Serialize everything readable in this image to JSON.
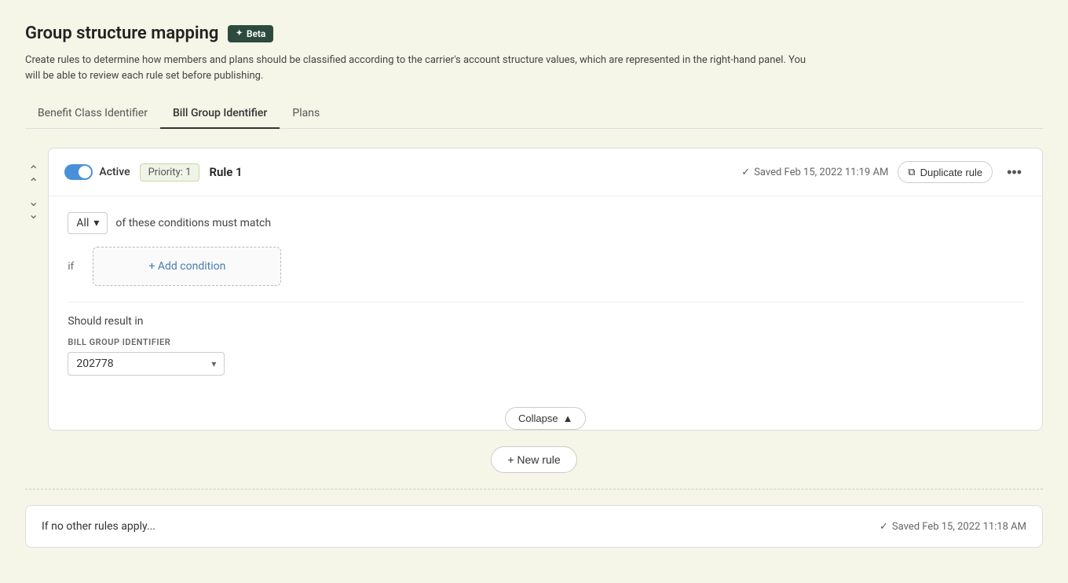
{
  "page": {
    "title": "Group structure mapping",
    "beta_label": "Beta",
    "description": "Create rules to determine how members and plans should be classified according to the carrier's account structure values, which are represented in the right-hand panel. You will be able to review each rule set before publishing."
  },
  "tabs": [
    {
      "id": "benefit-class",
      "label": "Benefit Class Identifier",
      "active": false
    },
    {
      "id": "bill-group",
      "label": "Bill Group Identifier",
      "active": true
    },
    {
      "id": "plans",
      "label": "Plans",
      "active": false
    }
  ],
  "rule": {
    "toggle_label": "Active",
    "priority_label": "Priority: 1",
    "name": "Rule 1",
    "saved_text": "Saved Feb 15, 2022 11:19 AM",
    "duplicate_label": "Duplicate rule",
    "condition_all_label": "All",
    "condition_text": "of these conditions must match",
    "if_label": "if",
    "add_condition_label": "+ Add condition",
    "should_result_label": "Should result in",
    "field_label": "BILL GROUP IDENTIFIER",
    "field_value": "202778",
    "collapse_label": "Collapse",
    "chevron_up": "▲"
  },
  "new_rule": {
    "label": "+ New rule"
  },
  "fallback": {
    "text": "If no other rules apply...",
    "saved_text": "Saved Feb 15, 2022 11:18 AM"
  }
}
